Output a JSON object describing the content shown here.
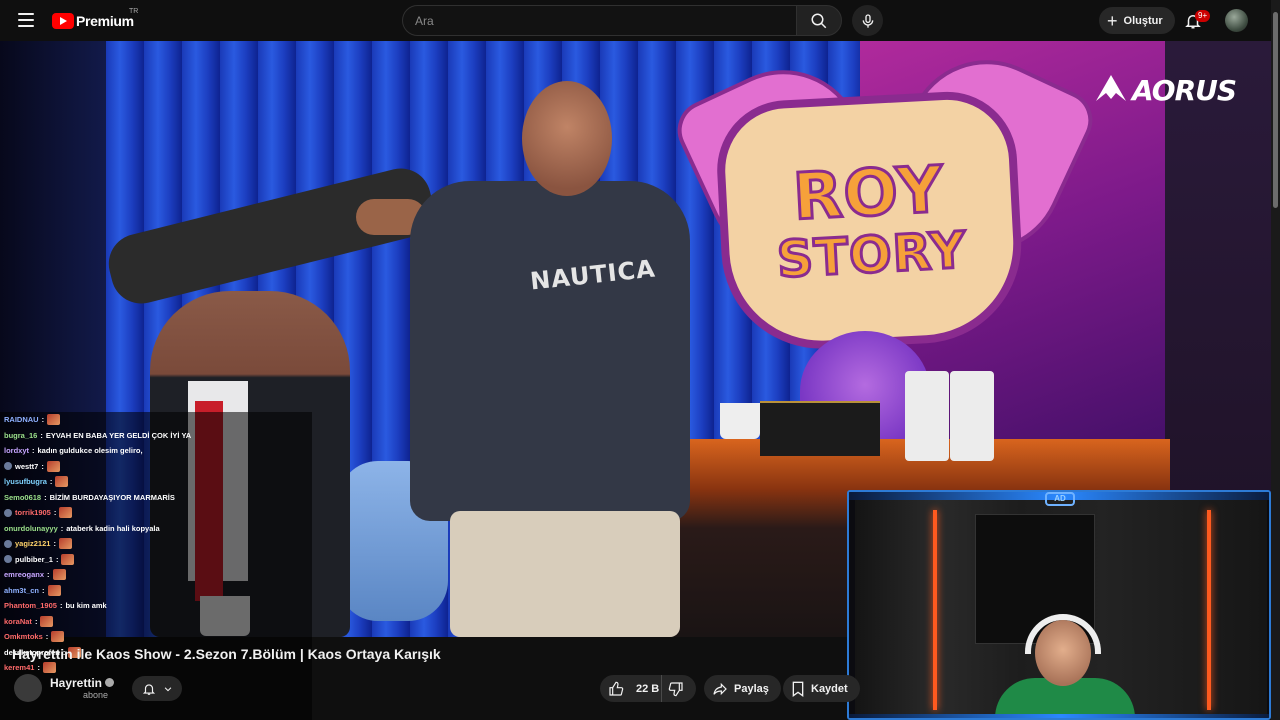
{
  "header": {
    "logo_text": "Premium",
    "country_code": "TR",
    "search_placeholder": "Ara",
    "create_label": "Oluştur",
    "notification_badge": "9+"
  },
  "video": {
    "sponsor_logo": "AORUS",
    "sign_line1": "ROY",
    "sign_line2": "STORY",
    "shirt_text": "NAUTICA",
    "cam_logo": "AD"
  },
  "chat": [
    {
      "user": "RAIDNAU",
      "color": "#8fb1ff",
      "msg": "",
      "emote": true
    },
    {
      "user": "bugra_16",
      "color": "#9be08a",
      "msg": "EYVAH EN BABA YER GELDİ ÇOK İYİ YA",
      "emote": false
    },
    {
      "user": "lordxyt",
      "color": "#c7a6ff",
      "msg": "kadın guldukce olesim geliro,",
      "emote": false
    },
    {
      "user": "westt7",
      "color": "#ffffff",
      "msg": "",
      "emote": true,
      "badge": true
    },
    {
      "user": "lyusufbugra",
      "color": "#7fd3ff",
      "msg": "",
      "emote": true
    },
    {
      "user": "Semo0618",
      "color": "#9be08a",
      "msg": "BİZİM BURDAYAŞIYOR MARMARİS",
      "emote": false
    },
    {
      "user": "torrik1905",
      "color": "#ff6a6a",
      "msg": "",
      "emote": true,
      "badge": true
    },
    {
      "user": "onurdolunayyy",
      "color": "#9be08a",
      "msg": "ataberk kadin hali kopyala",
      "emote": false
    },
    {
      "user": "yagiz2121",
      "color": "#ffd36a",
      "msg": "",
      "emote": true,
      "badge": true
    },
    {
      "user": "pulbiber_1",
      "color": "#ffffff",
      "msg": "",
      "emote": true,
      "badge": true
    },
    {
      "user": "emreoganx",
      "color": "#c7a6ff",
      "msg": "",
      "emote": true
    },
    {
      "user": "ahm3t_cn",
      "color": "#8fb1ff",
      "msg": "",
      "emote": true
    },
    {
      "user": "Phantom_1905",
      "color": "#ff6a6a",
      "msg": "bu kim amk",
      "emote": false
    },
    {
      "user": "koraNat",
      "color": "#ff6a6a",
      "msg": "",
      "emote": true
    },
    {
      "user": "Omkmtoks",
      "color": "#ff6a6a",
      "msg": "",
      "emote": true
    },
    {
      "user": "deksketoprofen",
      "color": "#ffffff",
      "msg": "",
      "emote": true
    },
    {
      "user": "kerem41",
      "color": "#ff6a6a",
      "msg": "",
      "emote": true
    }
  ],
  "details": {
    "title": "Hayrettin ile Kaos Show - 2.Sezon 7.Bölüm | Kaos Ortaya Karışık",
    "channel_name": "Hayrettin",
    "subscribers": "abone",
    "like_count": "22 B",
    "share_label": "Paylaş",
    "save_label": "Kaydet"
  }
}
